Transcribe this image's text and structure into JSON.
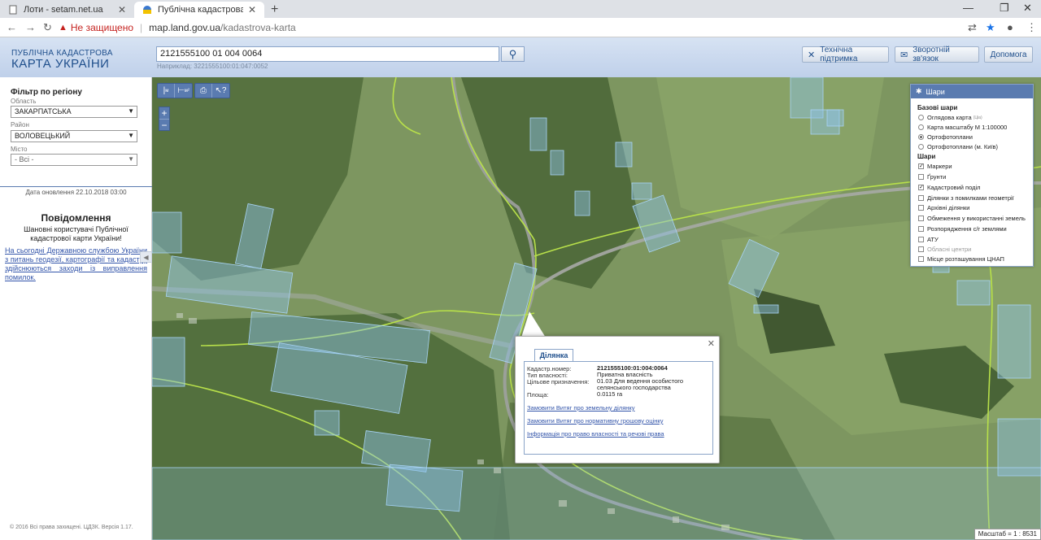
{
  "browser": {
    "tabs": [
      {
        "title": "Лоти - setam.net.ua",
        "active": false
      },
      {
        "title": "Публічна кадастрова карта Укр",
        "active": true
      }
    ],
    "address": {
      "insecure_label": "Не защищено",
      "host": "map.land.gov.ua",
      "path": "/kadastrova-karta"
    }
  },
  "header": {
    "logo_line1": "ПУБЛІЧНА КАДАСТРОВА",
    "logo_line2": "КАРТА УКРАЇНИ",
    "search_value": "2121555100 01 004 0064",
    "search_hint": "Наприклад: 3221555100:01:047:0052",
    "buttons": {
      "support": "Технічна підтримка",
      "feedback": "Зворотній зв'язок",
      "help": "Допомога"
    }
  },
  "sidebar": {
    "filter_title": "Фільтр по регіону",
    "region_label": "Область",
    "region_value": "ЗАКАРПАТСЬКА",
    "district_label": "Район",
    "district_value": "ВОЛОВЕЦЬКИЙ",
    "city_label": "Місто",
    "city_value": "- Всі -",
    "update_date": "Дата оновлення  22.10.2018 03:00",
    "message_title": "Повідомлення",
    "message_body": "Шановні користувачі Публічної кадастрової карти України!",
    "message_link": "На сьогодні Державною службою України з питань геодезії, картографії та кадастру здійснюються заходи із виправлення помилок.",
    "copyright": "© 2016 Всі права захищені. ЦДЗК. Версія 1.17."
  },
  "map": {
    "tool_labels": [
      "м",
      "м²"
    ],
    "zoom_in": "+",
    "zoom_out": "−",
    "scale": "Масштаб = 1 : 8531"
  },
  "layers": {
    "title": "Шари",
    "base_title": "Базові шари",
    "base": [
      {
        "label": "Оглядова карта",
        "sup": "(Ціа)",
        "on": false
      },
      {
        "label": "Карта масштабу М 1:100000",
        "on": false
      },
      {
        "label": "Ортофотоплани",
        "on": true
      },
      {
        "label": "Ортофотоплани (м. Київ)",
        "on": false
      }
    ],
    "overlay_title": "Шари",
    "overlays": [
      {
        "label": "Маркери",
        "on": true,
        "disabled": false
      },
      {
        "label": "Ґрунти",
        "on": false,
        "disabled": false
      },
      {
        "label": "Кадастровий поділ",
        "on": true,
        "disabled": false
      },
      {
        "label": "Ділянки з помилками геометрії",
        "on": false,
        "disabled": false
      },
      {
        "label": "Архівні ділянки",
        "on": false,
        "disabled": false
      },
      {
        "label": "Обмеження у використанні земель",
        "on": false,
        "disabled": false
      },
      {
        "label": "Розпорядження с/г землями",
        "on": false,
        "disabled": false
      },
      {
        "label": "АТУ",
        "on": false,
        "disabled": false
      },
      {
        "label": "Обласні центри",
        "on": false,
        "disabled": true
      },
      {
        "label": "Місце розташування ЦНАП",
        "on": false,
        "disabled": false
      }
    ]
  },
  "popup": {
    "tab": "Ділянка",
    "rows": [
      {
        "label": "Кадастр.номер:",
        "value": "2121555100:01:004:0064"
      },
      {
        "label": "Тип власності:",
        "value": "Приватна власність"
      },
      {
        "label": "Цільове призначення:",
        "value": "01.03 Для ведення особистого селянського господарства"
      },
      {
        "label": "Площа:",
        "value": "0.0115 га"
      }
    ],
    "links": [
      "Замовити Витяг про земельну ділянку",
      "Замовити Витяг про нормативну грошову оцінку",
      "Інформація про право власності та речові права"
    ]
  },
  "colors": {
    "accent": "#5a7bb0",
    "brand_text": "#1f4f8c",
    "parcel_fill": "#8fc3ec",
    "boundary": "#b8e04a"
  }
}
